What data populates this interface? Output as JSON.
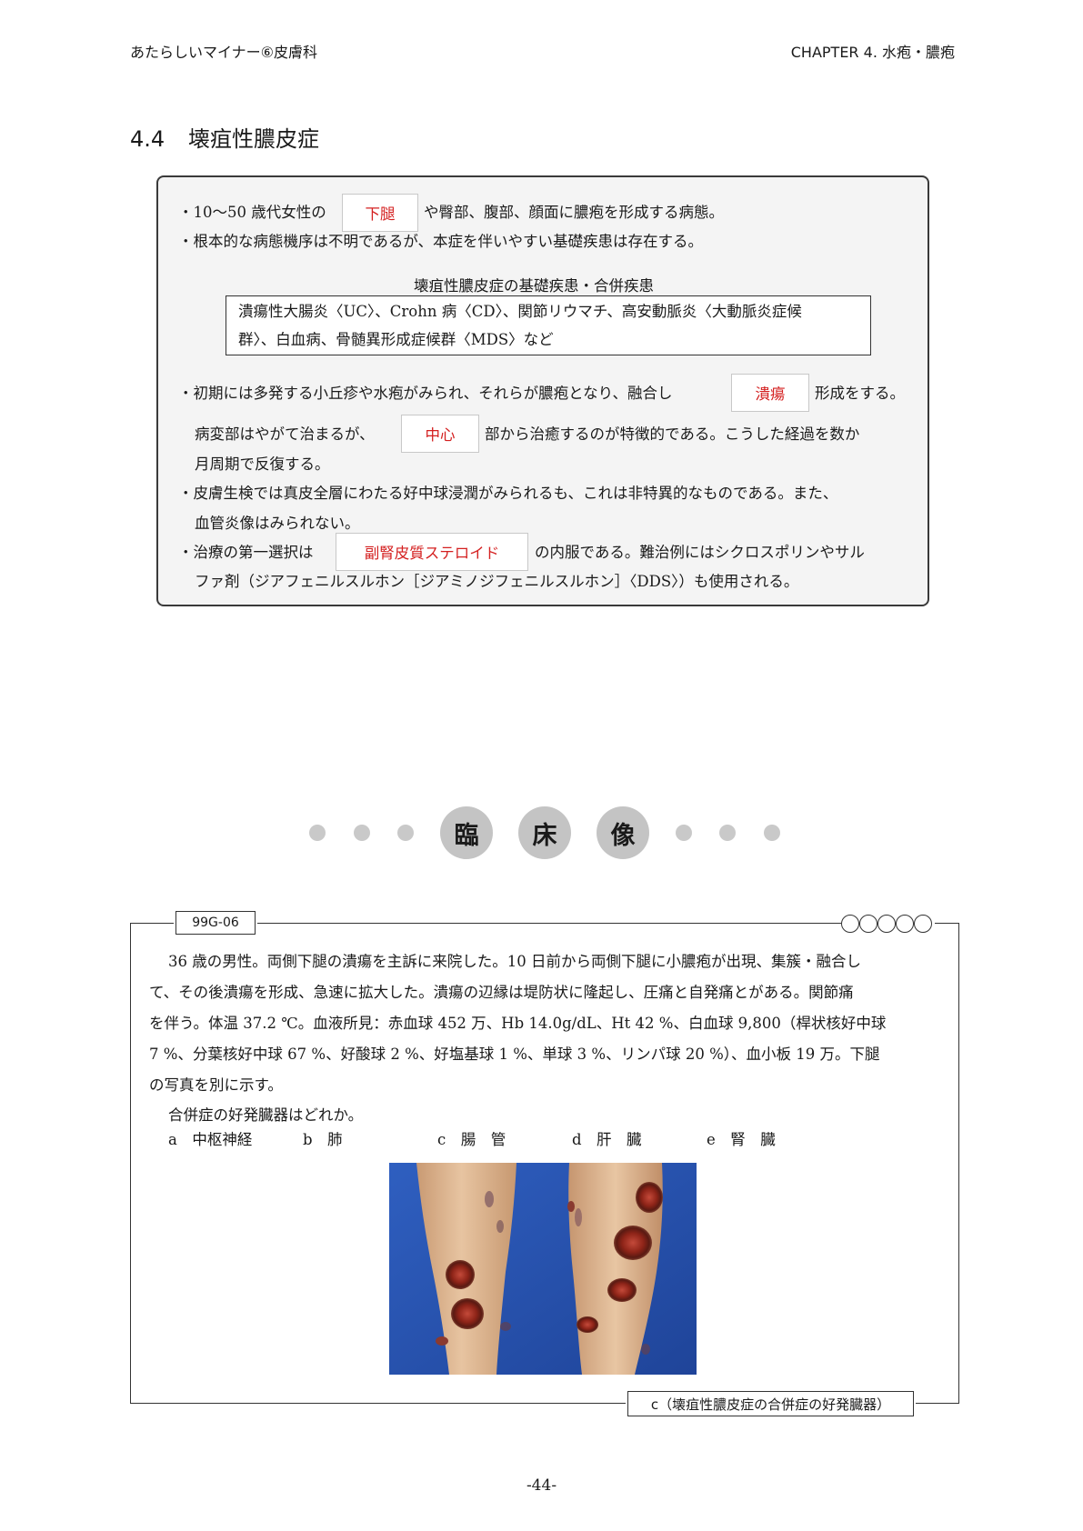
{
  "header": {
    "book_title": "あたらしいマイナー⑥皮膚科",
    "chapter": "CHAPTER 4. 水疱・膿疱"
  },
  "section": {
    "number": "4.4",
    "title": "壊疽性膿皮症"
  },
  "summary": {
    "l1_pre": "・10〜50 歳代女性の",
    "blank1": "下腿",
    "l1_post": "や臀部、腹部、顔面に膿疱を形成する病態。",
    "l2": "・根本的な病態機序は不明であるが、本症を伴いやすい基礎疾患は存在する。",
    "box_caption": "壊疽性膿皮症の基礎疾患・合併疾患",
    "box_line1": "潰瘍性大腸炎〈UC〉、Crohn 病〈CD〉、関節リウマチ、高安動脈炎〈大動脈炎症候",
    "box_line2": "群〉、白血病、骨髄異形成症候群〈MDS〉など",
    "l3_pre": "・初期には多発する小丘疹や水疱がみられ、それらが膿疱となり、融合し",
    "blank2": "潰瘍",
    "l3_post": "形成をする。",
    "l4_pre": "病変部はやがて治まるが、",
    "blank3": "中心",
    "l4_post": "部から治癒するのが特徴的である。こうした経過を数か",
    "l5": "月周期で反復する。",
    "l6": "・皮膚生検では真皮全層にわたる好中球浸潤がみられるも、これは非特異的なものである。また、",
    "l7": "血管炎像はみられない。",
    "l8_pre": "・治療の第一選択は",
    "blank4": "副腎皮質ステロイド",
    "l8_post": "の内服である。難治例にはシクロスポリンやサル",
    "l9": "ファ剤（ジアフェニルスルホン［ジアミノジフェニルスルホン］〈DDS〉）も使用される。"
  },
  "clinical_band": {
    "chars": [
      "臨",
      "床",
      "像"
    ]
  },
  "question": {
    "id": "99G-06",
    "lines": [
      "36 歳の男性。両側下腿の潰瘍を主訴に来院した。10 日前から両側下腿に小膿疱が出現、集簇・融合し",
      "て、その後潰瘍を形成、急速に拡大した。潰瘍の辺縁は堤防状に隆起し、圧痛と自発痛とがある。関節痛",
      "を伴う。体温 37.2 ℃。血液所見：赤血球 452 万、Hb 14.0g/dL、Ht 42 %、白血球 9,800（桿状核好中球",
      "7 %、分葉核好中球 67 %、好酸球 2 %、好塩基球 1 %、単球 3 %、リンパ球 20 %）、血小板 19 万。下腿",
      "の写真を別に示す。"
    ],
    "prompt": "合併症の好発臓器はどれか。",
    "choices": [
      "a　中枢神経",
      "b　肺",
      "c　腸　管",
      "d　肝　臓",
      "e　腎　臓"
    ],
    "answer": "c（壊疽性膿皮症の合併症の好発臓器）"
  },
  "page_number": "-44-",
  "colors": {
    "answer_red": "#d42020",
    "box_fill": "#f4f4f4",
    "band_gray": "#c4c4c4",
    "photo_background": "#2a56b3"
  }
}
